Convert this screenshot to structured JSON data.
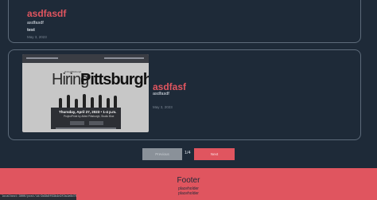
{
  "posts": [
    {
      "title": "asdfasdf",
      "subtitle": "asdfasdf",
      "body": "test",
      "date": "May 3, 2023"
    },
    {
      "title": "asdfasf",
      "subtitle": "asdfasdf",
      "date": "May 3, 2023",
      "image": {
        "brand": "HiringPittsburgh",
        "headline_part1": "Hiring",
        "headline_part2": "Pittsburgh",
        "event_line": "Thursday, April 27, 2023 • 1-4 p.m.",
        "location_line": "ProjectPride by Allied Pittsburgh, Studio Blue"
      }
    }
  ],
  "pagination": {
    "prev_label": "Previous",
    "page_label": "1/4",
    "next_label": "Next"
  },
  "footer": {
    "title": "Footer",
    "line1": "placeholder",
    "line2": "placeholder"
  },
  "status_url": "localhost:3000/post/id/9d3b8f63b4c9f2a1e8d76a5c",
  "colors": {
    "background": "#1e2a38",
    "accent": "#e0555f",
    "border": "#5d6b7a",
    "muted_button": "#8a9199"
  }
}
